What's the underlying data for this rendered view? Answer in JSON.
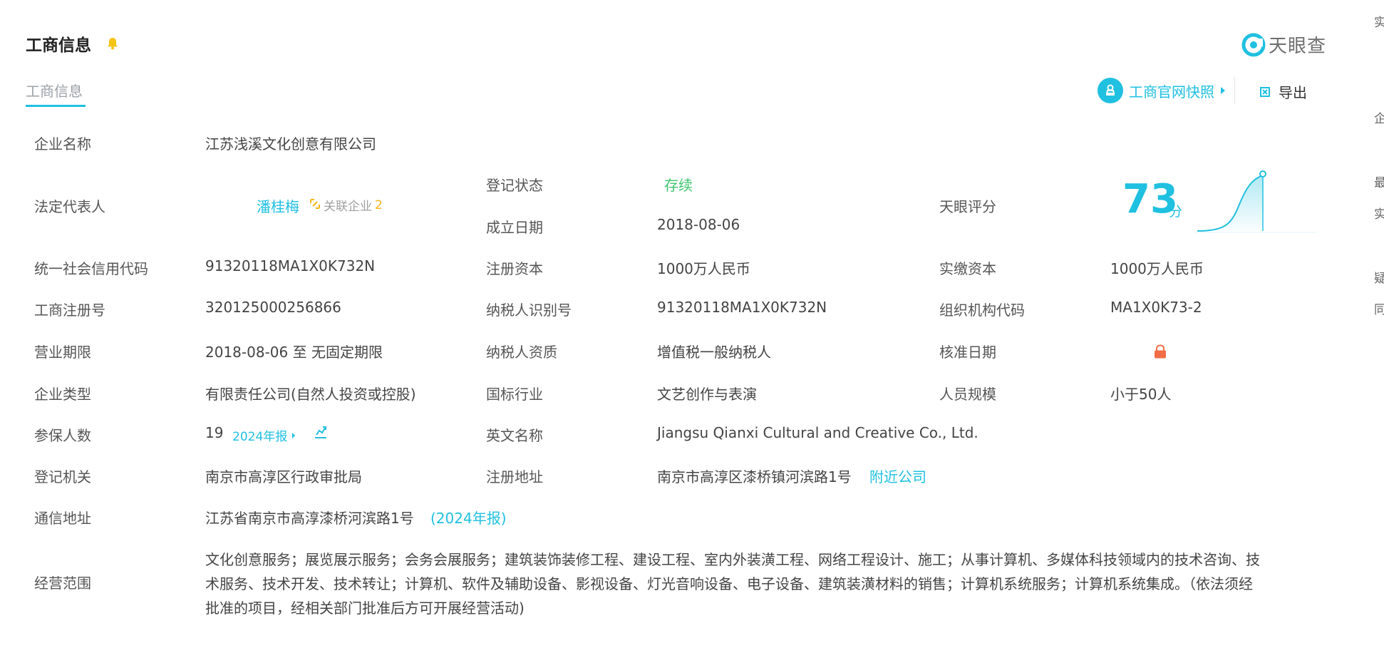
{
  "section": {
    "title": "工商信息",
    "tab": "工商信息"
  },
  "brand": {
    "logo_text": "天眼查"
  },
  "toolbar": {
    "snapshot_label": "工商官网快照",
    "export_label": "导出"
  },
  "fields": {
    "company_name": {
      "label": "企业名称",
      "value": "江苏浅溪文化创意有限公司"
    },
    "legal_rep": {
      "label": "法定代表人",
      "value": "潘桂梅",
      "related_label": "关联企业",
      "related_count": "2"
    },
    "reg_status": {
      "label": "登记状态",
      "value": "存续"
    },
    "found_date": {
      "label": "成立日期",
      "value": "2018-08-06"
    },
    "score": {
      "label": "天眼评分",
      "value": "73",
      "unit": "分"
    },
    "credit_code": {
      "label": "统一社会信用代码",
      "value": "91320118MA1X0K732N"
    },
    "reg_capital": {
      "label": "注册资本",
      "value": "1000万人民币"
    },
    "paid_capital": {
      "label": "实缴资本",
      "value": "1000万人民币"
    },
    "reg_no": {
      "label": "工商注册号",
      "value": "320125000256866"
    },
    "taxpayer_id": {
      "label": "纳税人识别号",
      "value": "91320118MA1X0K732N"
    },
    "org_code": {
      "label": "组织机构代码",
      "value": "MA1X0K73-2"
    },
    "term": {
      "label": "营业期限",
      "value": "2018-08-06 至 无固定期限"
    },
    "taxpayer_qual": {
      "label": "纳税人资质",
      "value": "增值税一般纳税人"
    },
    "approve_date": {
      "label": "核准日期"
    },
    "company_type": {
      "label": "企业类型",
      "value": "有限责任公司(自然人投资或控股)"
    },
    "industry": {
      "label": "国标行业",
      "value": "文艺创作与表演"
    },
    "staff_size": {
      "label": "人员规模",
      "value": "小于50人"
    },
    "insured": {
      "label": "参保人数",
      "value": "19",
      "report_link": "2024年报"
    },
    "english_name": {
      "label": "英文名称",
      "value": "Jiangsu Qianxi Cultural and Creative Co., Ltd."
    },
    "authority": {
      "label": "登记机关",
      "value": "南京市高淳区行政审批局"
    },
    "reg_address": {
      "label": "注册地址",
      "value": "南京市高淳区漆桥镇河滨路1号",
      "nearby_link": "附近公司"
    },
    "contact_address": {
      "label": "通信地址",
      "value": "江苏省南京市高淳漆桥河滨路1号",
      "report_link": "(2024年报)"
    },
    "scope": {
      "label": "经营范围",
      "lines": [
        "文化创意服务；展览展示服务；会务会展服务；建筑装饰装修工程、建设工程、室内外装潢工程、网络工程设计、施工；从事计算机、多媒体科技领域内的技术咨询、技",
        "术服务、技术开发、技术转让；计算机、软件及辅助设备、影视设备、灯光音响设备、电子设备、建筑装潢材料的销售；计算机系统服务；计算机系统集成。（依法须经",
        "批准的项目，经相关部门批准后方可开展经营活动)"
      ]
    }
  },
  "edge_chars": [
    "实",
    "企",
    "最",
    "实",
    "疑",
    "同"
  ],
  "colors": {
    "accent": "#1fc0e0",
    "status_green": "#3ec46d",
    "orange": "#f26d45",
    "bell": "#f6c417"
  }
}
